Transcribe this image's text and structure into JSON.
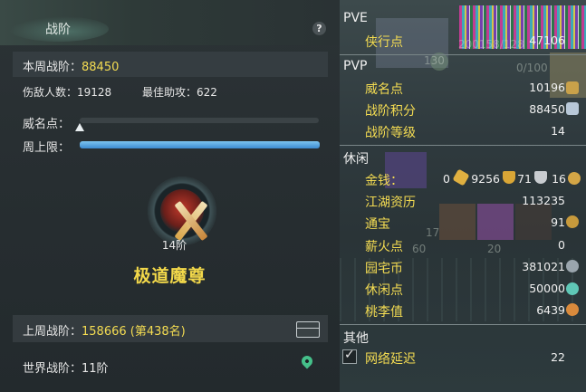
{
  "left": {
    "title": "战阶",
    "help": "?",
    "weekly_label": "本周战阶：",
    "weekly_value": "88450",
    "defeated_label": "伤敌人数：",
    "defeated_value": "19128",
    "assist_label": "最佳助攻：",
    "assist_value": "622",
    "fame_label": "威名点：",
    "fame_progress": 0.0,
    "weekly_cap_label": "周上限：",
    "weekly_cap_progress": 1.0,
    "rank_level": "14阶",
    "rank_name": "极道魔尊",
    "last_week_label": "上周战阶：",
    "last_week_value": "158666 (第438名)",
    "world_label": "世界战阶：",
    "world_value": "11阶"
  },
  "right": {
    "pve_header": "PVE",
    "pve_items": [
      {
        "label": "侠行点",
        "value": "47106"
      }
    ],
    "pvp_header": "PVP",
    "pvp_items": [
      {
        "label": "威名点",
        "value": "10196"
      },
      {
        "label": "战阶积分",
        "value": "88450"
      },
      {
        "label": "战阶等级",
        "value": "14"
      }
    ],
    "leisure_header": "休闲",
    "money_label": "金钱：",
    "money_values": [
      "0",
      "9256",
      "71",
      "16"
    ],
    "leisure_items": [
      {
        "label": "江湖资历",
        "value": "113235"
      },
      {
        "label": "通宝",
        "value": "91"
      },
      {
        "label": "薪火点",
        "value": "0"
      },
      {
        "label": "园宅币",
        "value": "381021"
      },
      {
        "label": "休闲点",
        "value": "50000"
      },
      {
        "label": "桃李值",
        "value": "6439"
      }
    ],
    "other_header": "其他",
    "other_items": [
      {
        "label": "网络延迟",
        "value": "22"
      }
    ],
    "bg_text": {
      "a": "200158/128",
      "b": "130",
      "c": "0/100",
      "d": "60",
      "e": "20",
      "f": "17"
    }
  },
  "colors": {
    "accent_yellow": "#f4dc52",
    "bar_blue": "#4a9ae0",
    "pin_green": "#45c08a"
  }
}
